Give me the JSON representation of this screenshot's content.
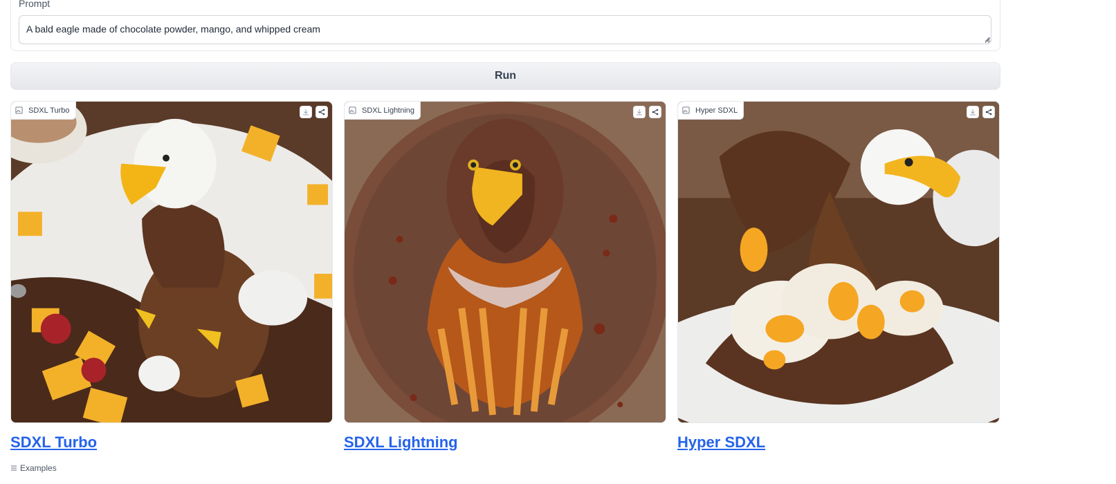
{
  "prompt": {
    "label": "Prompt",
    "value": "A bald eagle made of chocolate powder, mango, and whipped cream"
  },
  "run_button": {
    "label": "Run"
  },
  "results": [
    {
      "label": "SDXL Turbo",
      "link_text": "SDXL Turbo"
    },
    {
      "label": "SDXL Lightning",
      "link_text": "SDXL Lightning"
    },
    {
      "label": "Hyper SDXL",
      "link_text": "Hyper SDXL"
    }
  ],
  "examples": {
    "label": "Examples"
  },
  "icons": {
    "image": "image-icon",
    "download": "download-icon",
    "share": "share-icon",
    "list": "list-icon"
  },
  "colors": {
    "link": "#2563eb",
    "button_bg": "#e5e7eb",
    "border": "#e5e7eb"
  }
}
